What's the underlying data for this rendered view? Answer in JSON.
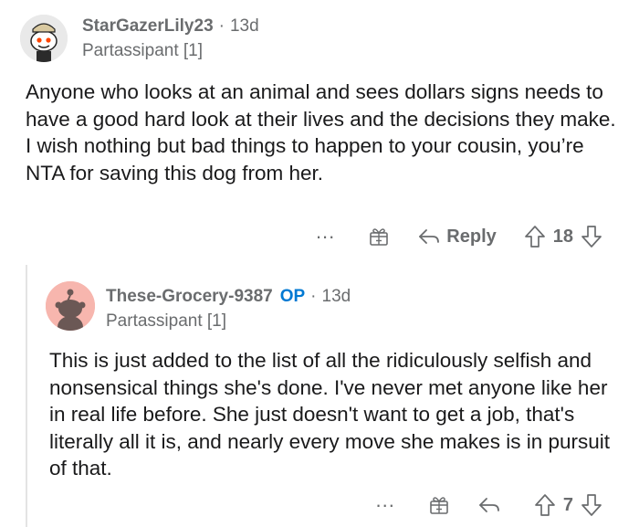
{
  "comments": [
    {
      "username": "StarGazerLily23",
      "separator": "·",
      "time": "13d",
      "flair": "Partassipant [1]",
      "body": "Anyone who looks at an animal and sees dollars signs needs to have a good hard look at their lives and the decisions they make. I wish nothing but bad things to happen to your cousin, you’re NTA for saving this dog from her.",
      "more_label": "...",
      "reply_label": "Reply",
      "score": "18",
      "avatar_icon": "snoo-avatar-icon"
    },
    {
      "username": "These-Grocery-9387",
      "op_tag": "OP",
      "separator": "·",
      "time": "13d",
      "flair": "Partassipant [1]",
      "body": "This is just added to the list of all the ridiculously selfish and nonsensical things she's done. I've never met anyone like her in real life before. She just doesn't want to get a job, that's literally all it is, and nearly every move she makes is in pursuit of that.",
      "more_label": "...",
      "reply_label": "",
      "score": "7",
      "avatar_icon": "snoo-avatar-icon"
    }
  ],
  "colors": {
    "meta": "#6a6c6e",
    "op": "#0079d3",
    "text": "#1a1a1b",
    "avatar2_bg": "#f7b6ae"
  }
}
